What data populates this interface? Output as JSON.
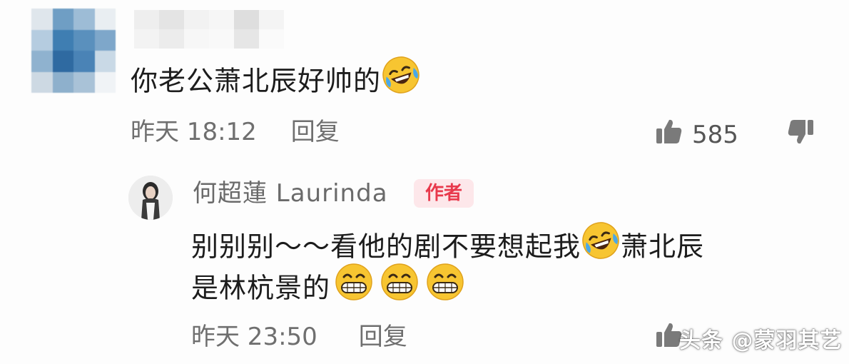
{
  "comment": {
    "text": "你老公萧北辰好帅的",
    "time": "昨天 18:12",
    "reply_label": "回复",
    "like_count": "585",
    "emojis": [
      "laugh-cry-emoji"
    ]
  },
  "reply": {
    "author_name": "何超蓮 Laurinda",
    "author_badge": "作者",
    "line1": "别别别～～看他的剧不要想起我",
    "line1_tail": "萧北辰",
    "line2": "是林杭景的",
    "time": "昨天 23:50",
    "reply_label": "回复",
    "emojis": [
      "laugh-cry-emoji",
      "grin-emoji",
      "grin-emoji",
      "grin-emoji"
    ]
  },
  "watermark": "头条 @蒙羽其艺",
  "colors": {
    "text_primary": "#1c1c1c",
    "text_meta": "#6f6f6f",
    "badge_bg": "#fde7ea",
    "badge_text": "#e8394c",
    "emoji_yellow": "#f7c531"
  }
}
